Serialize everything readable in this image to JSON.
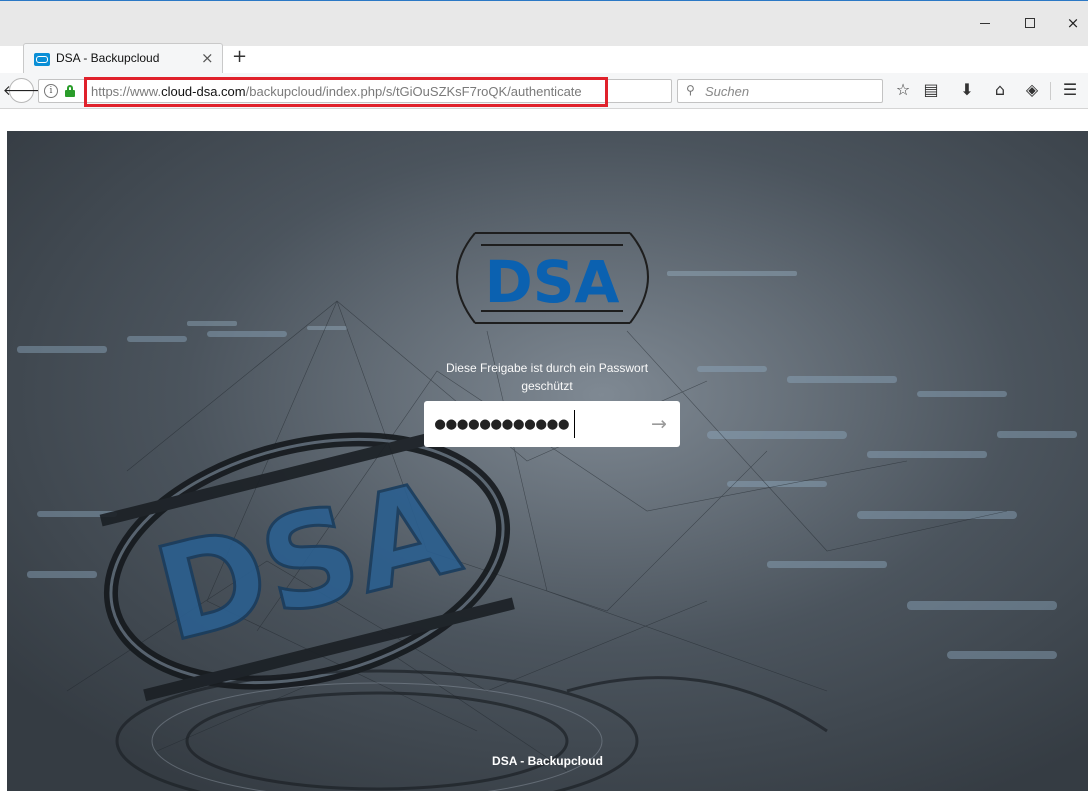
{
  "browser": {
    "tab": {
      "title": "DSA - Backupcloud",
      "close": "×"
    },
    "new_tab": "+",
    "window_controls": {
      "close": "×"
    },
    "address_bar": {
      "url_prefix": "https://www.",
      "url_domain": "cloud-dsa.com",
      "url_path": "/backupcloud/index.php/s/tGiOuSZKsF7roQK/authenticate"
    },
    "search": {
      "placeholder": "Suchen"
    },
    "icons": [
      "back-arrow-icon",
      "info-icon",
      "lock-icon",
      "reload-icon",
      "search-icon",
      "star-icon",
      "reader-list-icon",
      "download-icon",
      "home-icon",
      "pocket-icon",
      "hamburger-menu-icon"
    ]
  },
  "page": {
    "logo": {
      "text": "DSA",
      "color": "#0b61b0"
    },
    "message": "Diese Freigabe ist durch ein Passwort geschützt",
    "password": {
      "masked_value": "●●●●●●●●●●●●"
    },
    "submit_symbol": "→",
    "footer": "DSA - Backupcloud"
  },
  "colors": {
    "url_highlight": "#e0212b",
    "lock_green": "#2a9d2a",
    "page_overlay": "#3f4750"
  }
}
